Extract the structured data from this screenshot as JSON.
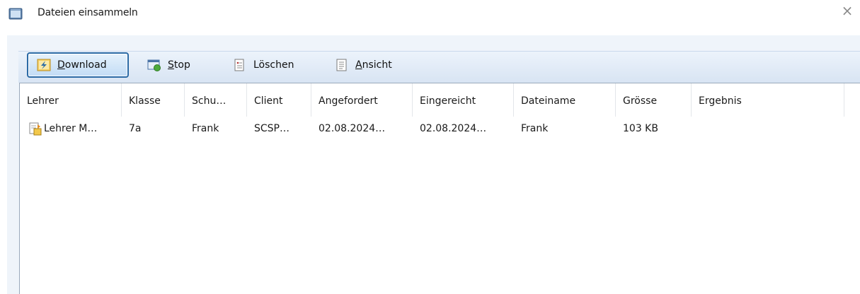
{
  "window": {
    "title": "Dateien einsammeln",
    "close_glyph": "×"
  },
  "toolbar": {
    "buttons": [
      {
        "accel": "D",
        "rest": "ownload",
        "icon": "download-icon",
        "active": true
      },
      {
        "accel": "S",
        "rest": "top",
        "icon": "stop-icon",
        "active": false
      },
      {
        "accel": "",
        "rest": "Löschen",
        "icon": "delete-icon",
        "active": false
      },
      {
        "accel": "A",
        "rest": "nsicht",
        "icon": "view-icon",
        "active": false
      }
    ]
  },
  "table": {
    "columns": [
      "Lehrer",
      "Klasse",
      "Schu…",
      "Client",
      "Angefordert",
      "Eingereicht",
      "Dateiname",
      "Grösse",
      "Ergebnis"
    ],
    "rows": [
      {
        "icon": "teacher-file-icon",
        "cells": [
          "Lehrer M…",
          "7a",
          "Frank",
          "SCSP…",
          "02.08.2024…",
          "02.08.2024…",
          "Frank",
          "103 KB",
          ""
        ]
      }
    ]
  },
  "colors": {
    "accent_border": "#2b6aa5",
    "toolbar_bg": "#dce7f4",
    "client_bg": "#eff4fa"
  }
}
